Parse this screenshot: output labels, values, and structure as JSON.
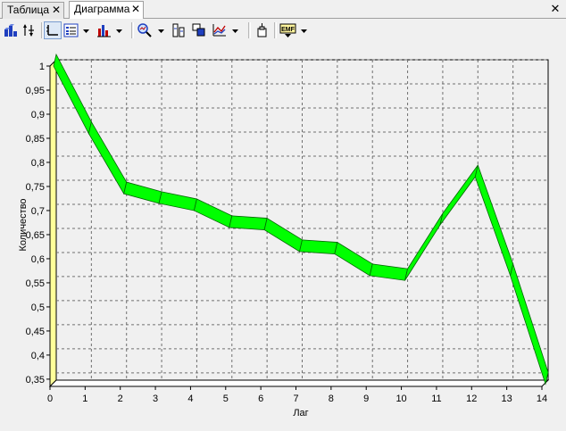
{
  "tabs": [
    {
      "label": "Таблица",
      "active": false
    },
    {
      "label": "Диаграмма",
      "active": true
    }
  ],
  "toolbar_icons": [
    "chart-3d-icon",
    "axis-swap-icon",
    "axes-icon",
    "legend-icon",
    "bar-chart-type-icon",
    "zoom-icon",
    "series-icon",
    "layers-icon",
    "line-chart-icon",
    "clipboard-icon",
    "emf-export-icon"
  ],
  "chart_data": {
    "type": "line",
    "title": "",
    "xlabel": "Лаг",
    "ylabel": "Количество",
    "x": [
      0,
      1,
      2,
      3,
      4,
      5,
      6,
      7,
      8,
      9,
      10,
      11,
      12,
      13,
      14
    ],
    "series": [
      {
        "values": [
          1.0,
          0.86,
          0.735,
          0.715,
          0.7,
          0.665,
          0.66,
          0.615,
          0.61,
          0.565,
          0.555,
          0.67,
          0.77,
          0.565,
          0.34
        ]
      }
    ],
    "ylim": [
      0.335,
      1.0
    ],
    "xlim": [
      0,
      14
    ],
    "yticks": [
      "1",
      "0,95",
      "0,9",
      "0,85",
      "0,8",
      "0,75",
      "0,7",
      "0,65",
      "0,6",
      "0,55",
      "0,5",
      "0,45",
      "0,4",
      "0,35"
    ],
    "ytick_values": [
      1,
      0.95,
      0.9,
      0.85,
      0.8,
      0.75,
      0.7,
      0.65,
      0.6,
      0.55,
      0.5,
      0.45,
      0.4,
      0.35
    ],
    "xticks": [
      "0",
      "1",
      "2",
      "3",
      "4",
      "5",
      "6",
      "7",
      "8",
      "9",
      "10",
      "11",
      "12",
      "13",
      "14"
    ],
    "grid": true,
    "legend": "none",
    "colors": {
      "series": "#00ff00",
      "series_edge": "#006400",
      "wall": "#ffff99",
      "plot_bg": "#f0f0f0",
      "grid": "#707070"
    }
  }
}
